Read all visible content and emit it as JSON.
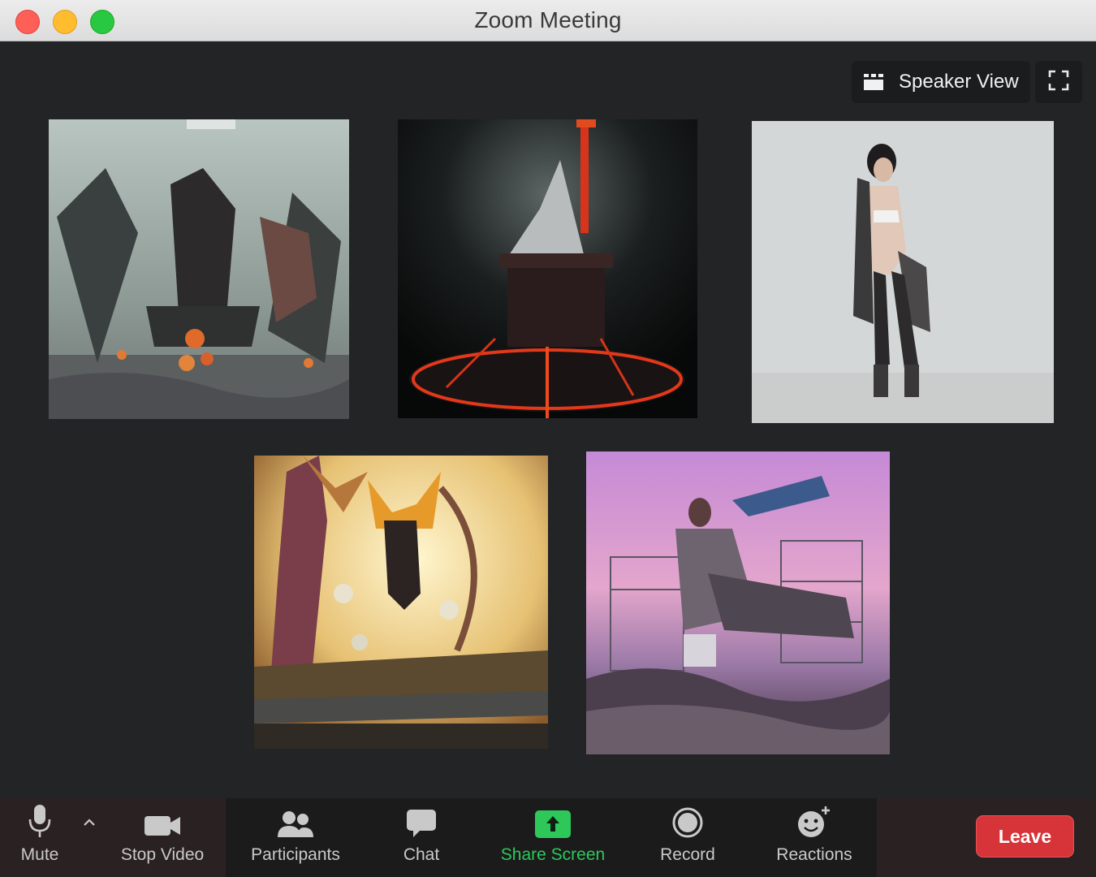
{
  "window": {
    "title": "Zoom Meeting"
  },
  "view_controls": {
    "view_label": "Speaker View",
    "view_icon": "grid-icon",
    "fullscreen_icon": "fullscreen-icon"
  },
  "participants": [
    {
      "tile": 1
    },
    {
      "tile": 2
    },
    {
      "tile": 3
    },
    {
      "tile": 4
    },
    {
      "tile": 5
    }
  ],
  "toolbar": {
    "mute_label": "Mute",
    "video_label": "Stop Video",
    "participants_label": "Participants",
    "chat_label": "Chat",
    "share_label": "Share Screen",
    "record_label": "Record",
    "reactions_label": "Reactions",
    "leave_label": "Leave",
    "share_color": "#2ec85a",
    "leave_color": "#d63438"
  }
}
